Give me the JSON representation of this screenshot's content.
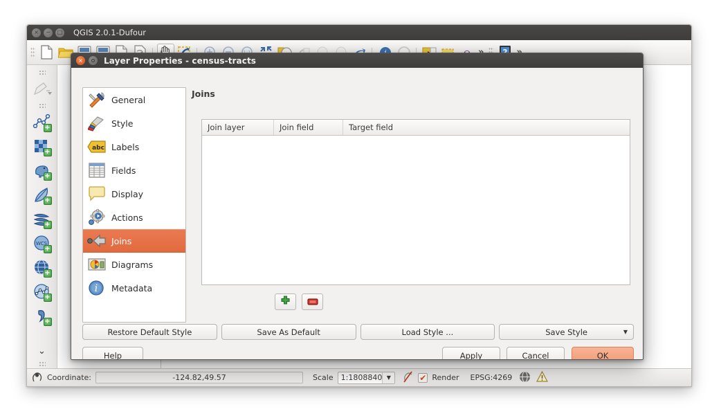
{
  "app": {
    "title": "QGIS 2.0.1-Dufour",
    "window_buttons": [
      "close",
      "minimize",
      "maximize"
    ]
  },
  "toolbar": {
    "icons": [
      "new-project-icon",
      "open-project-icon",
      "save-project-icon",
      "save-project-as-icon",
      "new-print-composer-icon",
      "composer-manager-icon",
      "pan-map-icon",
      "pan-to-selection-icon",
      "zoom-in-icon",
      "zoom-out-icon",
      "zoom-full-icon",
      "zoom-to-selection-icon",
      "zoom-to-layer-icon",
      "zoom-last-icon",
      "zoom-next-icon",
      "refresh-icon",
      "identify-features-icon",
      "measure-line-icon",
      "select-features-icon",
      "deselect-features-icon",
      "open-field-calculator-icon"
    ],
    "overflow_label": "»",
    "help_icon": "help-icon"
  },
  "left_rail": {
    "icons": [
      "toggle-editing-icon",
      "add-vector-layer-icon",
      "add-raster-layer-icon",
      "add-postgis-layer-icon",
      "add-spatialite-layer-icon",
      "add-mssql-layer-icon",
      "add-wcs-layer-icon",
      "add-wms-layer-icon",
      "add-wfs-layer-icon",
      "add-delimited-text-layer-icon"
    ],
    "overflow_label": "⌄"
  },
  "statusbar": {
    "locator_icon": "locator-icon",
    "coordinate_label": "Coordinate:",
    "coordinate_value": "-124.82,49.57",
    "scale_label": "Scale",
    "scale_value": "1:1808840",
    "scale_caret": "▼",
    "magnifier_icon": "rotation-icon",
    "render_label": "Render",
    "render_checked": "✔",
    "crs_label": "EPSG:4269",
    "crs_icon": "crs-status-icon",
    "messages_icon": "messages-warning-icon"
  },
  "dialog": {
    "title": "Layer Properties - census-tracts",
    "close_glyph": "×",
    "nav": [
      {
        "label": "General",
        "icon": "general-icon",
        "selected": false
      },
      {
        "label": "Style",
        "icon": "style-icon",
        "selected": false
      },
      {
        "label": "Labels",
        "icon": "labels-icon",
        "selected": false
      },
      {
        "label": "Fields",
        "icon": "fields-icon",
        "selected": false
      },
      {
        "label": "Display",
        "icon": "display-icon",
        "selected": false
      },
      {
        "label": "Actions",
        "icon": "actions-icon",
        "selected": false
      },
      {
        "label": "Joins",
        "icon": "joins-icon",
        "selected": true
      },
      {
        "label": "Diagrams",
        "icon": "diagrams-icon",
        "selected": false
      },
      {
        "label": "Metadata",
        "icon": "metadata-icon",
        "selected": false
      }
    ],
    "pane_title": "Joins",
    "table": {
      "columns": [
        "Join layer",
        "Join field",
        "Target field"
      ],
      "rows": []
    },
    "add_join_icon": "add-join-icon",
    "remove_join_icon": "remove-join-icon",
    "style_buttons": [
      {
        "label": "Restore Default Style",
        "name": "restore-default-style-button"
      },
      {
        "label": "Save As Default",
        "name": "save-as-default-button"
      },
      {
        "label": "Load Style ...",
        "name": "load-style-button"
      },
      {
        "label": "Save Style",
        "name": "save-style-button",
        "caret": "▼"
      }
    ],
    "help_label": "Help",
    "apply_label": "Apply",
    "cancel_label": "Cancel",
    "ok_label": "OK"
  },
  "colors": {
    "selection_orange": "#e26a3f",
    "ok_button": "#f0a078",
    "titlebar_dark": "#403e3d",
    "map_polygon": "#4e80b5",
    "dialog_bg": "#f2f1f0"
  }
}
